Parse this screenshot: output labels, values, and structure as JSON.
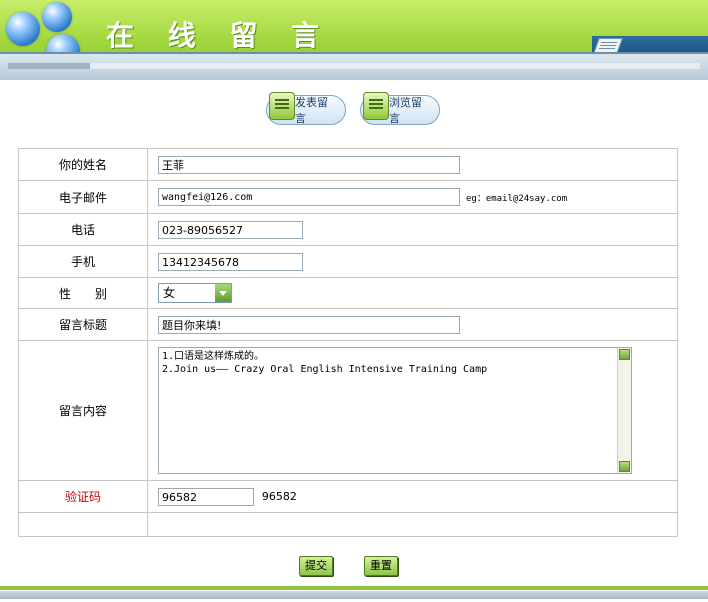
{
  "header": {
    "title": "在 线 留 言"
  },
  "nav": {
    "post_label": "发表留言",
    "browse_label": "浏览留言"
  },
  "form": {
    "name": {
      "label": "你的姓名",
      "value": "王菲"
    },
    "email": {
      "label": "电子邮件",
      "value": "wangfei@126.com",
      "hint": "eg：email@24say.com"
    },
    "phone": {
      "label": "电话",
      "value": "023-89056527"
    },
    "mobile": {
      "label": "手机",
      "value": "13412345678"
    },
    "gender": {
      "label": "性　　别",
      "value": "女"
    },
    "subject": {
      "label": "留言标题",
      "value": "题目你来填!"
    },
    "content": {
      "label": "留言内容",
      "lines": [
        "1.口语是这样炼成的。",
        "2.Join us—— Crazy Oral English Intensive Training Camp"
      ]
    },
    "captcha": {
      "label": "验证码",
      "value": "96582",
      "code": "96582"
    }
  },
  "actions": {
    "submit_label": "提交",
    "reset_label": "重置"
  },
  "colors": {
    "header_green": "#9fd63b",
    "required_label": "#cc0000",
    "border": "#c7c7c7"
  }
}
